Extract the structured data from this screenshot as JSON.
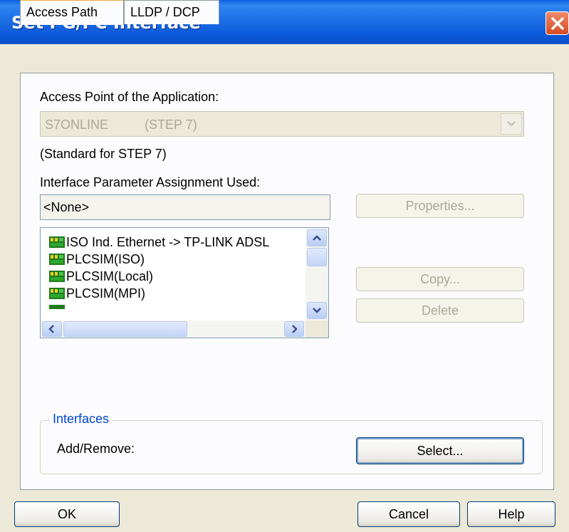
{
  "window": {
    "title": "Set PG/PC Interface"
  },
  "tabs": [
    {
      "label": "Access Path",
      "active": true
    },
    {
      "label": "LLDP / DCP",
      "active": false
    }
  ],
  "access_point": {
    "label": "Access Point of the Application:",
    "value_name": "S7ONLINE",
    "value_desc": "(STEP 7)",
    "note": "(Standard for STEP 7)"
  },
  "param_assignment": {
    "label": "Interface Parameter Assignment Used:",
    "value": "<None>",
    "items": [
      {
        "label": "ISO Ind. Ethernet -> TP-LINK ADSL",
        "icon": "network-adapter-icon"
      },
      {
        "label": "PLCSIM(ISO)",
        "icon": "network-adapter-icon"
      },
      {
        "label": "PLCSIM(Local)",
        "icon": "network-adapter-icon"
      },
      {
        "label": "PLCSIM(MPI)",
        "icon": "network-adapter-icon"
      }
    ]
  },
  "buttons": {
    "properties": "Properties...",
    "copy": "Copy...",
    "delete": "Delete",
    "select": "Select...",
    "ok": "OK",
    "cancel": "Cancel",
    "help": "Help"
  },
  "interfaces": {
    "group_title": "Interfaces",
    "add_remove_label": "Add/Remove:"
  },
  "colors": {
    "title_bar": "#1e6fe6",
    "close_button": "#d64a22",
    "active_tab_highlight": "#f2a93b",
    "group_title": "#0046d5"
  }
}
